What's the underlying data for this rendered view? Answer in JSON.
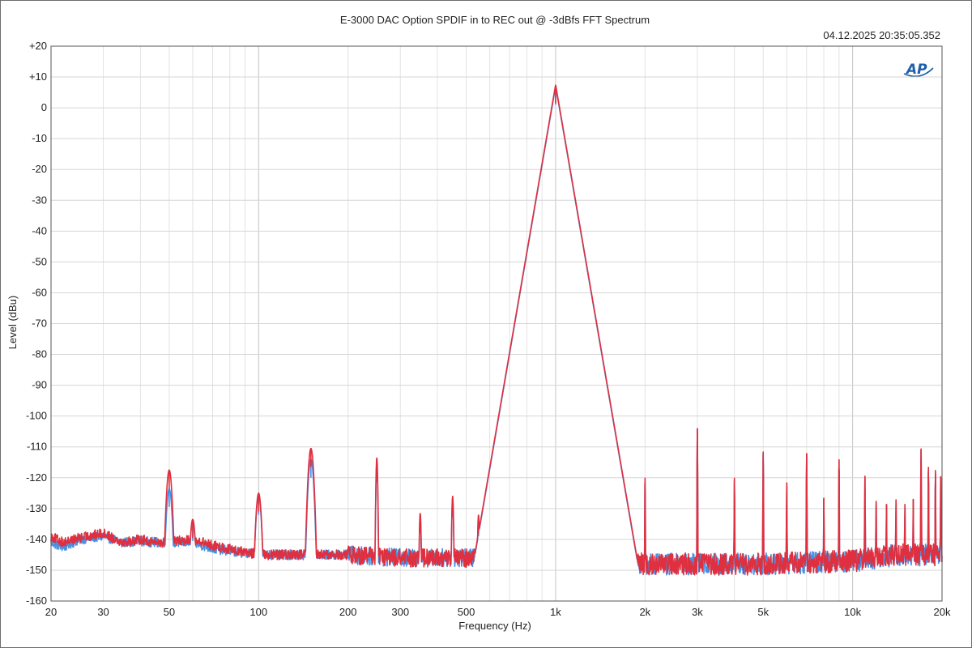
{
  "chart_data": {
    "type": "line",
    "title": "E-3000 DAC Option SPDIF in to REC out @ -3dBfs FFT Spectrum",
    "timestamp": "04.12.2025 20:35:05.352",
    "logo_text": "AP",
    "xlabel": "Frequency (Hz)",
    "ylabel": "Level (dBu)",
    "x_scale": "log",
    "xlim": [
      20,
      20000
    ],
    "ylim": [
      -160,
      20
    ],
    "grid": true,
    "x_ticks": [
      {
        "value": 20,
        "label": "20"
      },
      {
        "value": 30,
        "label": "30"
      },
      {
        "value": 50,
        "label": "50"
      },
      {
        "value": 100,
        "label": "100"
      },
      {
        "value": 200,
        "label": "200"
      },
      {
        "value": 300,
        "label": "300"
      },
      {
        "value": 500,
        "label": "500"
      },
      {
        "value": 1000,
        "label": "1k"
      },
      {
        "value": 2000,
        "label": "2k"
      },
      {
        "value": 3000,
        "label": "3k"
      },
      {
        "value": 5000,
        "label": "5k"
      },
      {
        "value": 10000,
        "label": "10k"
      },
      {
        "value": 20000,
        "label": "20k"
      }
    ],
    "y_ticks": [
      {
        "value": 20,
        "label": "+20"
      },
      {
        "value": 10,
        "label": "+10"
      },
      {
        "value": 0,
        "label": "0"
      },
      {
        "value": -10,
        "label": "-10"
      },
      {
        "value": -20,
        "label": "-20"
      },
      {
        "value": -30,
        "label": "-30"
      },
      {
        "value": -40,
        "label": "-40"
      },
      {
        "value": -50,
        "label": "-50"
      },
      {
        "value": -60,
        "label": "-60"
      },
      {
        "value": -70,
        "label": "-70"
      },
      {
        "value": -80,
        "label": "-80"
      },
      {
        "value": -90,
        "label": "-90"
      },
      {
        "value": -100,
        "label": "-100"
      },
      {
        "value": -110,
        "label": "-110"
      },
      {
        "value": -120,
        "label": "-120"
      },
      {
        "value": -130,
        "label": "-130"
      },
      {
        "value": -140,
        "label": "-140"
      },
      {
        "value": -150,
        "label": "-150"
      },
      {
        "value": -160,
        "label": "-160"
      }
    ],
    "series": [
      {
        "color": "#4a90e2",
        "floor": [
          [
            20,
            -141
          ],
          [
            22,
            -142.5
          ],
          [
            25,
            -140
          ],
          [
            30,
            -139
          ],
          [
            35,
            -141
          ],
          [
            40,
            -140.5
          ],
          [
            45,
            -141
          ],
          [
            48,
            -141
          ],
          [
            60,
            -141
          ],
          [
            70,
            -143
          ],
          [
            100,
            -145
          ],
          [
            200,
            -145
          ],
          [
            300,
            -146
          ],
          [
            500,
            -146
          ],
          [
            700,
            -145
          ],
          [
            900,
            -143
          ],
          [
            1200,
            -146
          ],
          [
            2000,
            -148
          ],
          [
            5000,
            -148
          ],
          [
            10000,
            -147
          ],
          [
            14000,
            -145
          ],
          [
            20000,
            -145
          ]
        ],
        "peaks": [
          [
            50,
            -123.5
          ],
          [
            60,
            -134.5
          ],
          [
            100,
            -126
          ],
          [
            150,
            -114
          ],
          [
            250,
            -115.5
          ],
          [
            350,
            -132
          ],
          [
            450,
            -127
          ],
          [
            550,
            -133
          ],
          [
            1000,
            7
          ],
          [
            2000,
            -120.5
          ],
          [
            3000,
            -104.5
          ],
          [
            4000,
            -121
          ],
          [
            5000,
            -112
          ],
          [
            6000,
            -122.5
          ],
          [
            7000,
            -112.5
          ],
          [
            8000,
            -127
          ],
          [
            9000,
            -114.5
          ],
          [
            11000,
            -120
          ],
          [
            12000,
            -128
          ],
          [
            13000,
            -129
          ],
          [
            14000,
            -127.5
          ],
          [
            15000,
            -129
          ],
          [
            16000,
            -127.5
          ],
          [
            17000,
            -111
          ],
          [
            18000,
            -117
          ],
          [
            19000,
            -118
          ],
          [
            19800,
            -120
          ]
        ]
      },
      {
        "color": "#e02f3e",
        "floor": [
          [
            20,
            -139
          ],
          [
            22,
            -141
          ],
          [
            25,
            -139.5
          ],
          [
            30,
            -138
          ],
          [
            35,
            -141
          ],
          [
            40,
            -140
          ],
          [
            45,
            -141
          ],
          [
            48,
            -141
          ],
          [
            60,
            -140
          ],
          [
            70,
            -142
          ],
          [
            100,
            -145
          ],
          [
            200,
            -145
          ],
          [
            300,
            -146
          ],
          [
            500,
            -146
          ],
          [
            700,
            -145
          ],
          [
            900,
            -143
          ],
          [
            1200,
            -146
          ],
          [
            2000,
            -148
          ],
          [
            5000,
            -148
          ],
          [
            10000,
            -147
          ],
          [
            14000,
            -145
          ],
          [
            20000,
            -145
          ]
        ],
        "peaks": [
          [
            50,
            -117.5
          ],
          [
            60,
            -133.5
          ],
          [
            100,
            -125
          ],
          [
            150,
            -110.5
          ],
          [
            250,
            -113.5
          ],
          [
            350,
            -131.5
          ],
          [
            450,
            -126
          ],
          [
            550,
            -132
          ],
          [
            1000,
            7.5
          ],
          [
            2000,
            -120
          ],
          [
            3000,
            -104
          ],
          [
            4000,
            -120
          ],
          [
            5000,
            -111.5
          ],
          [
            6000,
            -121.5
          ],
          [
            7000,
            -112
          ],
          [
            8000,
            -126.5
          ],
          [
            9000,
            -114
          ],
          [
            11000,
            -119.5
          ],
          [
            12000,
            -127.5
          ],
          [
            13000,
            -128.5
          ],
          [
            14000,
            -127
          ],
          [
            15000,
            -128.5
          ],
          [
            16000,
            -127
          ],
          [
            17000,
            -110.5
          ],
          [
            18000,
            -116.5
          ],
          [
            19000,
            -117.5
          ],
          [
            19800,
            -119.5
          ]
        ]
      }
    ]
  }
}
